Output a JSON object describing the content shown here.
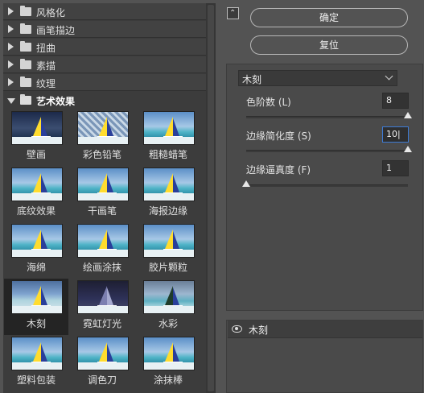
{
  "categories": [
    {
      "label": "风格化",
      "expanded": false
    },
    {
      "label": "画笔描边",
      "expanded": false
    },
    {
      "label": "扭曲",
      "expanded": false
    },
    {
      "label": "素描",
      "expanded": false
    },
    {
      "label": "纹理",
      "expanded": false
    },
    {
      "label": "艺术效果",
      "expanded": true
    }
  ],
  "filters": [
    {
      "label": "壁画"
    },
    {
      "label": "彩色铅笔"
    },
    {
      "label": "粗糙蜡笔"
    },
    {
      "label": "底纹效果"
    },
    {
      "label": "干画笔"
    },
    {
      "label": "海报边缘"
    },
    {
      "label": "海绵"
    },
    {
      "label": "绘画涂抹"
    },
    {
      "label": "胶片颗粒"
    },
    {
      "label": "木刻",
      "selected": true
    },
    {
      "label": "霓虹灯光"
    },
    {
      "label": "水彩"
    },
    {
      "label": "塑料包装"
    },
    {
      "label": "调色刀"
    },
    {
      "label": "涂抹棒"
    }
  ],
  "buttons": {
    "collapse_icon": "collapse-icon",
    "ok_label": "确定",
    "reset_label": "复位"
  },
  "settings": {
    "filter_select": "木刻",
    "params": [
      {
        "label": "色阶数 (L)",
        "value": "8",
        "fraction": 1.0
      },
      {
        "label": "边缘简化度 (S)",
        "value": "10|",
        "fraction": 1.0,
        "focused": true
      },
      {
        "label": "边缘逼真度 (F)",
        "value": "1",
        "fraction": 0.0
      }
    ]
  },
  "layers": {
    "items": [
      {
        "label": "木刻",
        "visible": true
      }
    ]
  },
  "colors": {
    "background": "#535353",
    "panel": "#3c3c3c",
    "focus": "#3d7bd6"
  }
}
